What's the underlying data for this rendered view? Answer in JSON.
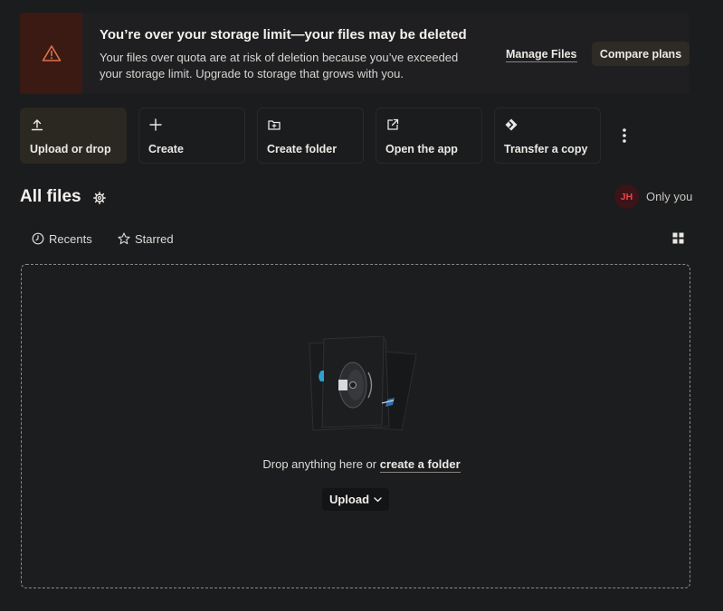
{
  "banner": {
    "title": "You’re over your storage limit—your files may be deleted",
    "body": "Your files over quota are at risk of deletion because you’ve exceeded your storage limit. Upgrade to storage that grows with you.",
    "manage_label": "Manage Files",
    "compare_label": "Compare plans",
    "warning_icon": "warning-triangle-icon"
  },
  "actions": [
    {
      "label": "Upload or drop",
      "icon": "upload-icon"
    },
    {
      "label": "Create",
      "icon": "plus-icon"
    },
    {
      "label": "Create folder",
      "icon": "folder-plus-icon"
    },
    {
      "label": "Open the app",
      "icon": "external-link-icon"
    },
    {
      "label": "Transfer a copy",
      "icon": "transfer-icon"
    }
  ],
  "header": {
    "title": "All files",
    "avatar_initials": "JH",
    "sharing": "Only you"
  },
  "tabs": [
    {
      "label": "Recents",
      "icon": "clock-icon"
    },
    {
      "label": "Starred",
      "icon": "star-icon"
    }
  ],
  "dropzone": {
    "text": "Drop anything here or",
    "link": "create a folder",
    "upload_label": "Upload"
  },
  "colors": {
    "background": "#1b1c1e",
    "warning_bg": "#3a1a12",
    "warning_icon": "#e0704e",
    "primary_tile": "#2b2822",
    "avatar_bg": "#3c1418",
    "avatar_text": "#e2494a"
  }
}
